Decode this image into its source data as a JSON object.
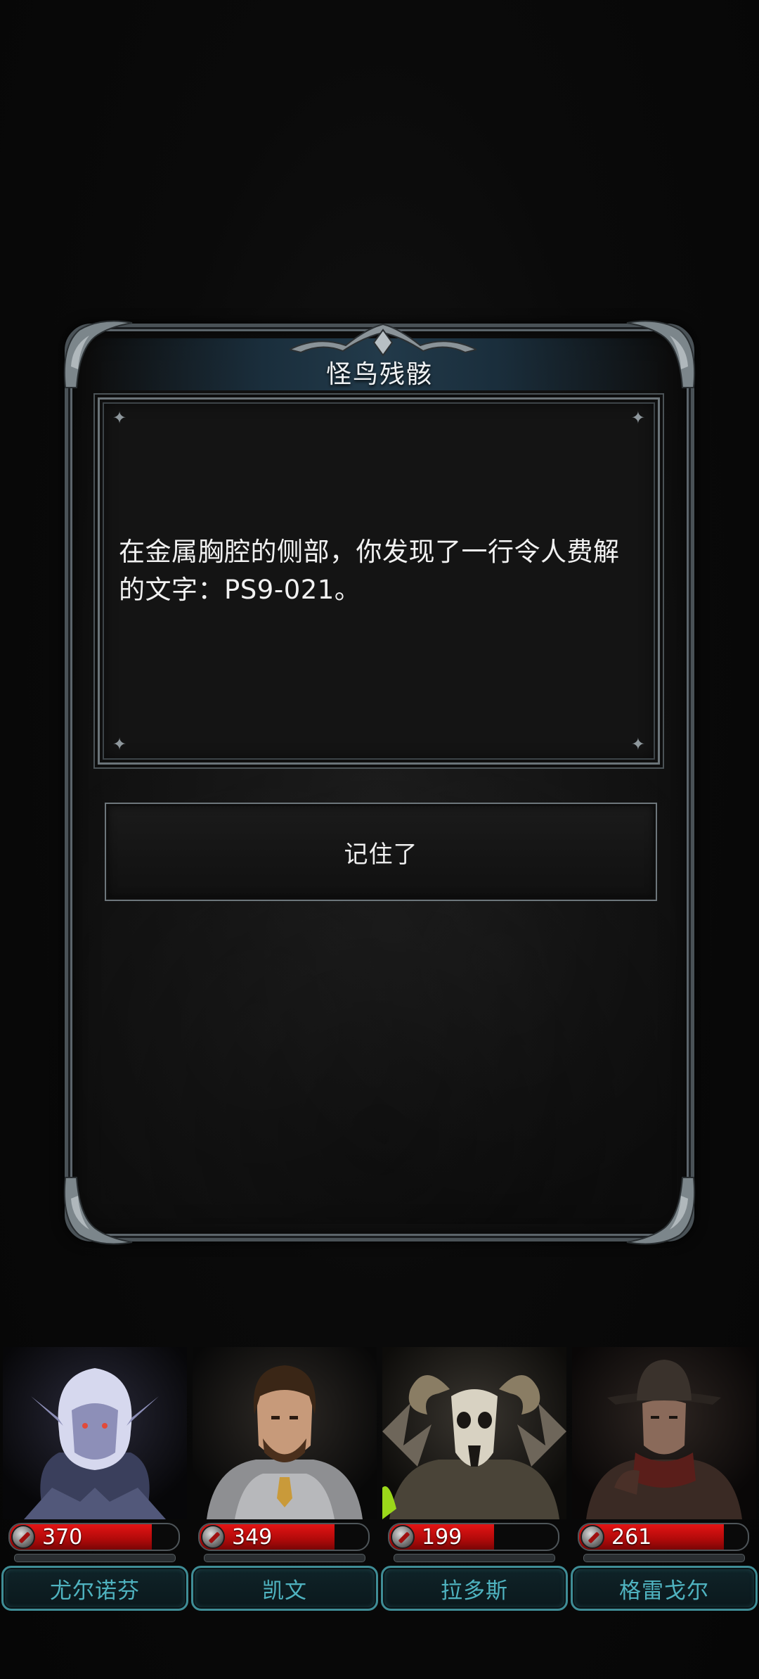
{
  "dialog": {
    "title": "怪鸟残骸",
    "body": "在金属胸腔的侧部，你发现了一行令人费解的文字：PS9-021。",
    "confirm_label": "记住了"
  },
  "party": [
    {
      "name": "尤尔诺芬",
      "hp": "370",
      "hp_fraction": 0.84,
      "portrait_icon": "dark-elf-portrait"
    },
    {
      "name": "凯文",
      "hp": "349",
      "hp_fraction": 0.8,
      "portrait_icon": "knight-portrait"
    },
    {
      "name": "拉多斯",
      "hp": "199",
      "hp_fraction": 0.62,
      "portrait_icon": "ram-skull-shaman-portrait"
    },
    {
      "name": "格雷戈尔",
      "hp": "261",
      "hp_fraction": 0.86,
      "portrait_icon": "hunter-portrait"
    }
  ],
  "colors": {
    "background": "#070707",
    "hp_red": "#d01212",
    "name_teal": "#4fb3c0",
    "frame_steel": "#6b7479"
  }
}
